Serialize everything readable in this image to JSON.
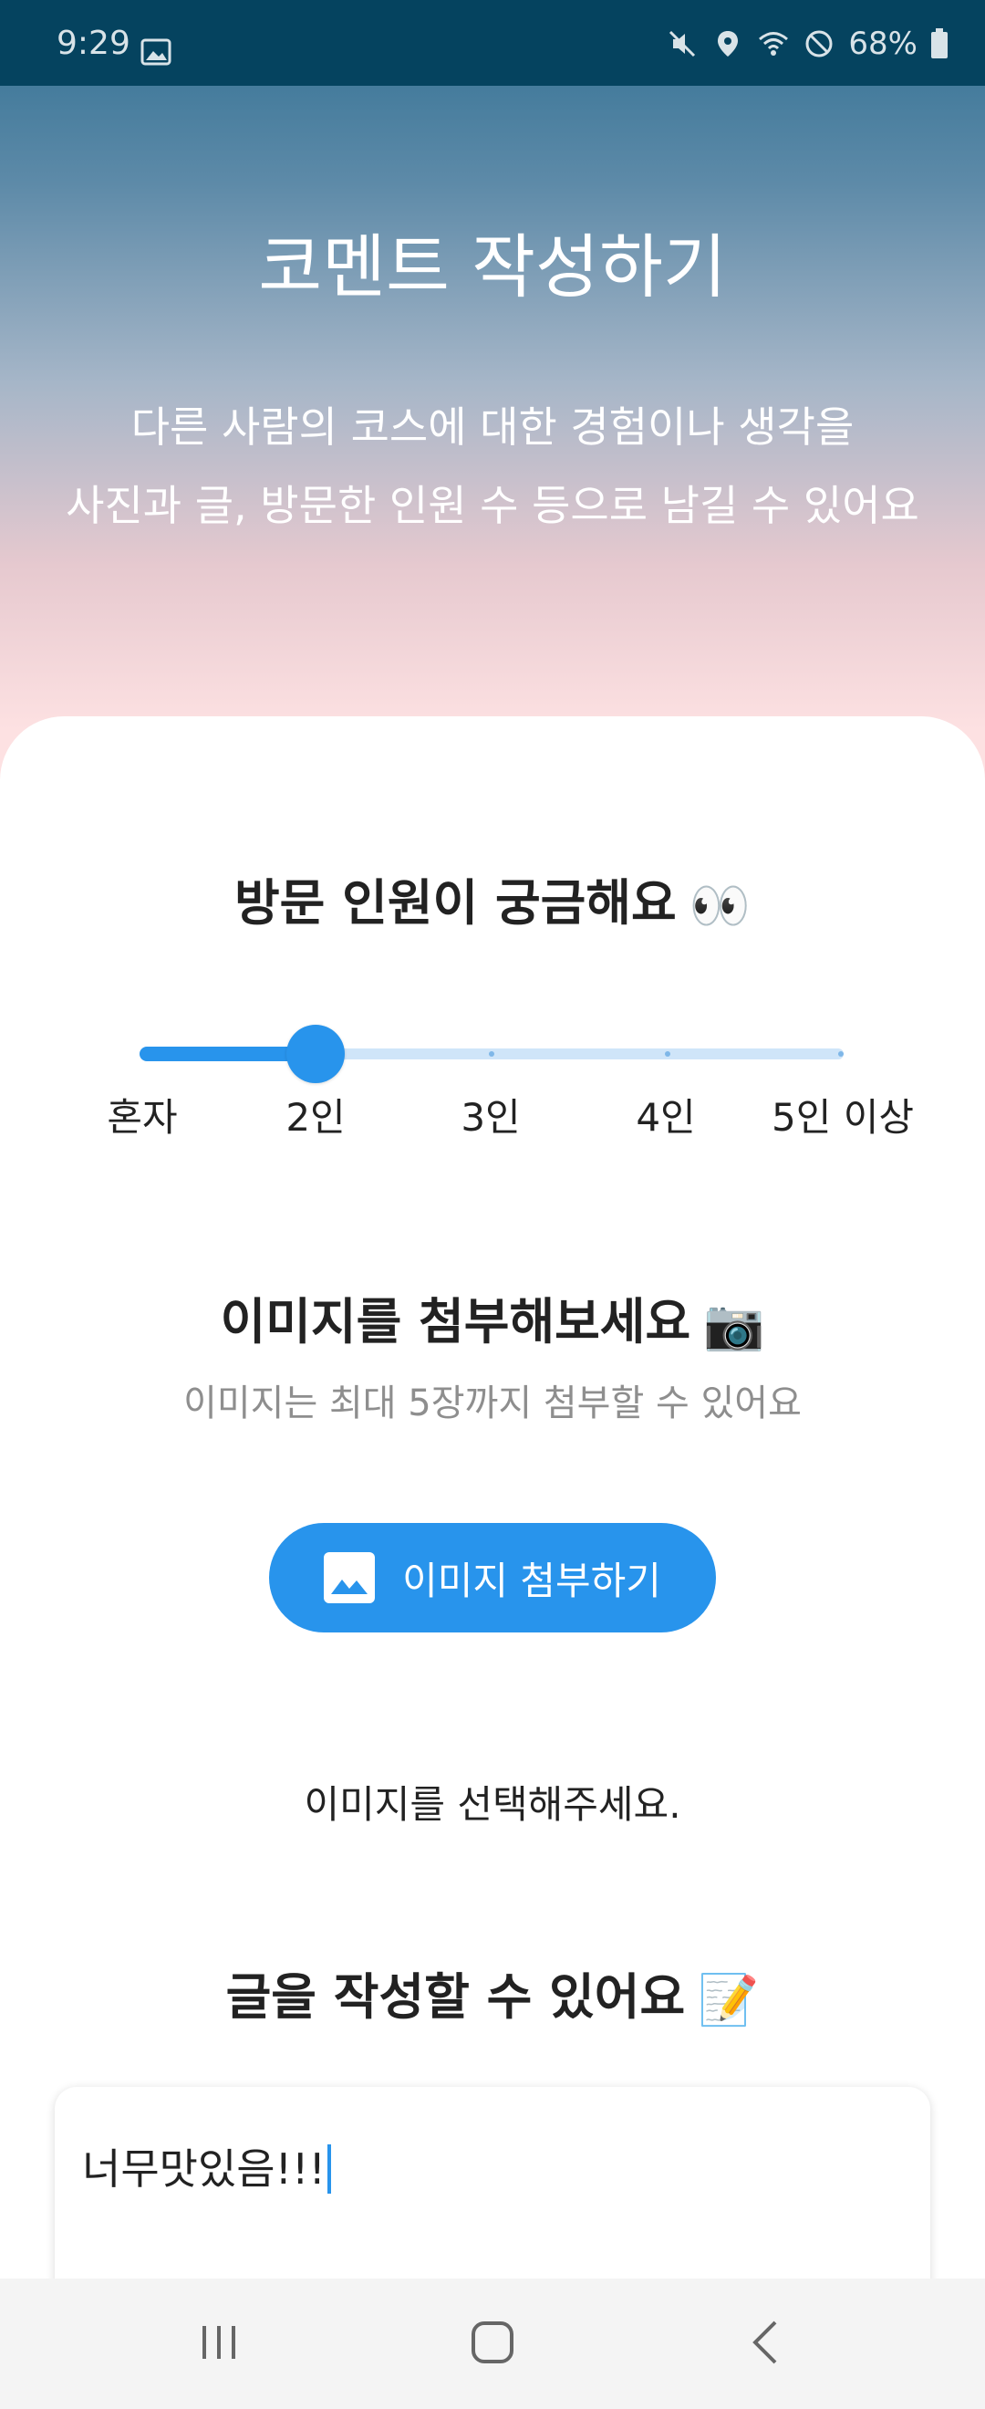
{
  "status_bar": {
    "time": "9:29",
    "battery": "68%"
  },
  "header": {
    "title": "코멘트 작성하기",
    "desc_line1": "다른 사람의 코스에 대한 경험이나 생각을",
    "desc_line2": "사진과 글, 방문한 인원 수 등으로 남길 수 있어요"
  },
  "visitors": {
    "title": "방문 인원이 궁금해요",
    "emoji": "👀",
    "options": [
      "혼자",
      "2인",
      "3인",
      "4인",
      "5인 이상"
    ],
    "selected_index": 1,
    "selected_value": 0.25
  },
  "images": {
    "title": "이미지를 첨부해보세요",
    "emoji": "📷",
    "desc": "이미지는 최대 5장까지 첨부할 수 있어요",
    "button_label": "이미지 첨부하기",
    "empty_hint": "이미지를 선택해주세요."
  },
  "comment": {
    "title": "글을 작성할 수 있어요",
    "emoji": "📝",
    "value": "너무맛있음!!!"
  },
  "colors": {
    "accent": "#2894ec",
    "status_bar": "#05435f"
  },
  "icons": {
    "status": [
      "gallery-icon",
      "mute-icon",
      "location-icon",
      "wifi-icon",
      "block-icon",
      "battery-icon"
    ],
    "nav": [
      "recents-icon",
      "home-icon",
      "back-icon"
    ]
  }
}
